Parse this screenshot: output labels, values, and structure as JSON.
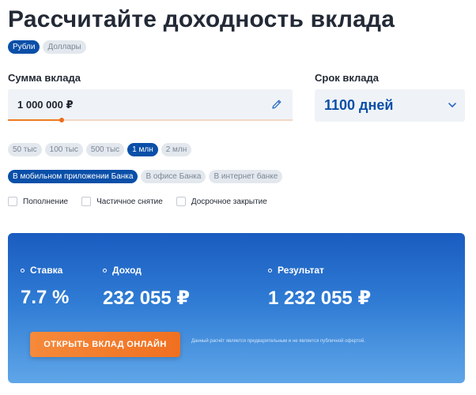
{
  "title": "Рассчитайте доходность вклада",
  "currency_tabs": [
    {
      "label": "Рубли",
      "active": true
    },
    {
      "label": "Доллары",
      "active": false
    }
  ],
  "amount": {
    "label": "Сумма вклада",
    "value": "1 000 000 ₽",
    "slider_fraction": 0.19
  },
  "term": {
    "label": "Срок вклада",
    "value": "1100 дней"
  },
  "amount_presets": [
    {
      "label": "50 тыс",
      "active": false
    },
    {
      "label": "100 тыс",
      "active": false
    },
    {
      "label": "500 тыс",
      "active": false
    },
    {
      "label": "1 млн",
      "active": true
    },
    {
      "label": "2 млн",
      "active": false
    }
  ],
  "channels": [
    {
      "label": "В мобильном приложении Банка",
      "active": true
    },
    {
      "label": "В офисе Банка",
      "active": false
    },
    {
      "label": "В интернет банке",
      "active": false
    }
  ],
  "options": [
    {
      "label": "Пополнение",
      "checked": false
    },
    {
      "label": "Частичное снятие",
      "checked": false
    },
    {
      "label": "Досрочное закрытие",
      "checked": false
    }
  ],
  "results": {
    "rate_label": "Ставка",
    "rate_value": "7.7 %",
    "income_label": "Доход",
    "income_value": "232 055 ₽",
    "total_label": "Результат",
    "total_value": "1 232 055 ₽"
  },
  "cta_label": "ОТКРЫТЬ ВКЛАД ОНЛАЙН",
  "disclaimer": "Данный расчёт является предварительным и не является публичной офертой.",
  "colors": {
    "primary": "#0a4fa8",
    "accent_orange": "#f07a24",
    "chip_bg": "#e3e8ee",
    "panel_top": "#1a5cc0",
    "panel_bottom": "#5fa6e8"
  },
  "icons": {
    "edit": "pencil-icon",
    "term_dropdown": "chevron-down-icon"
  }
}
